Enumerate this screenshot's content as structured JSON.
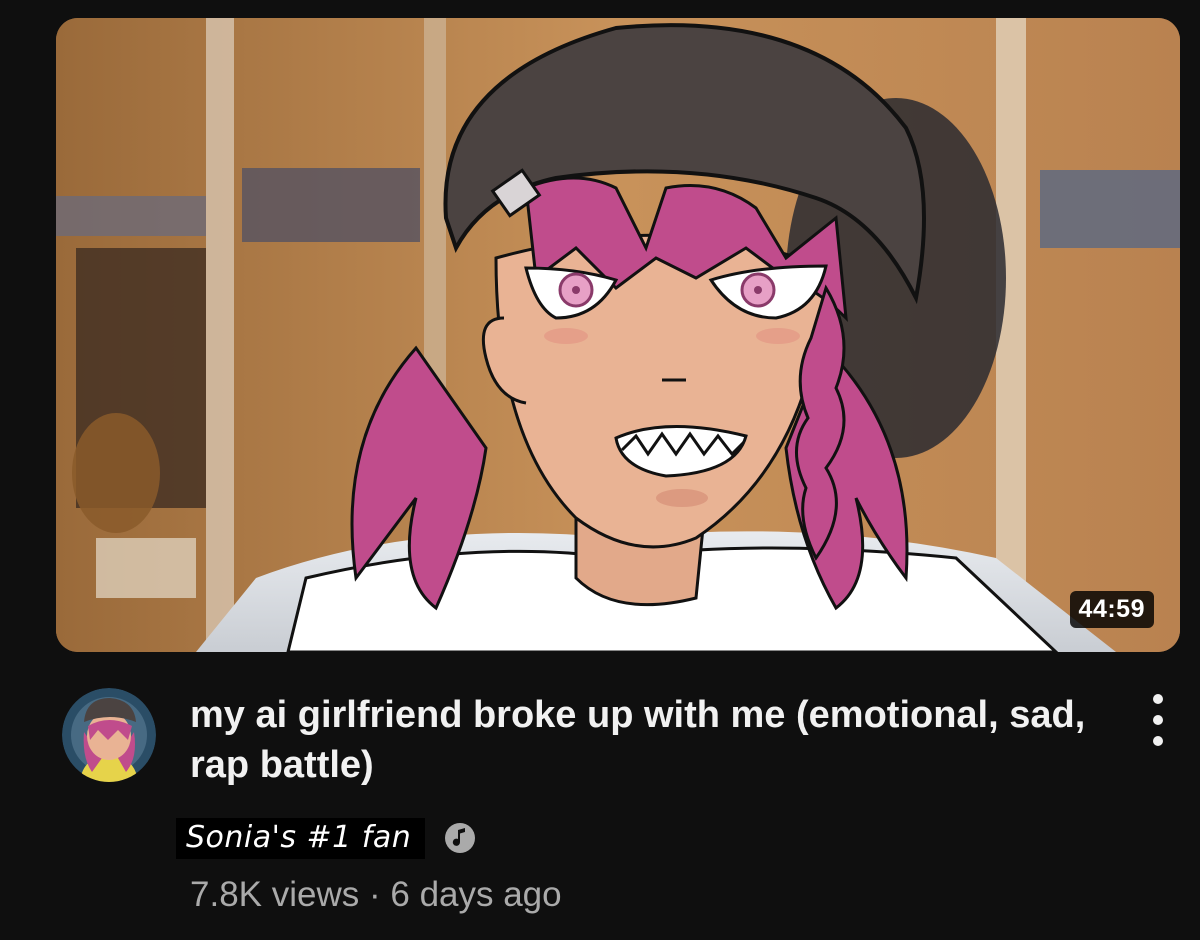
{
  "video": {
    "duration": "44:59",
    "title": "my ai girlfriend broke up with me (emotional, sad, rap battle)",
    "channel": "Sonia's #1 fan",
    "views": "7.8K views",
    "separator": "·",
    "age": "6 days ago"
  },
  "icons": {
    "menu": "more-vert-icon",
    "badge": "music-note-badge-icon"
  },
  "colors": {
    "background": "#0f0f0f",
    "title": "#f1f1f1",
    "meta": "#aaaaaa",
    "hair": "#c04c8c",
    "beanie": "#4b4341"
  }
}
